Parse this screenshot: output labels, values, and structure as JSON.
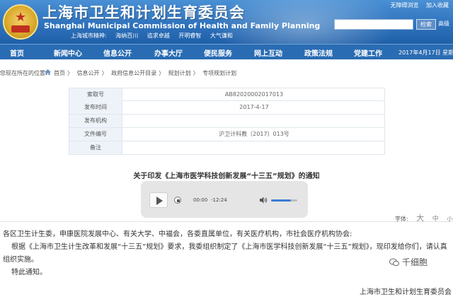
{
  "header": {
    "title_cn": "上海市卫生和计划生育委员会",
    "title_en": "Shanghai Municipal Commission of Health and Family Planning",
    "spirit_label": "上海城市精神:",
    "spirit_items": [
      "海纳百川",
      "追求卓越",
      "开明睿智",
      "大气谦和"
    ],
    "top_links": [
      "无障碍浏览",
      "加入收藏"
    ],
    "search_placeholder": "",
    "search_button": "检索",
    "advanced_search": "高级"
  },
  "nav": {
    "items": [
      "首页",
      "新闻中心",
      "信息公开",
      "办事大厅",
      "便民服务",
      "网上互动",
      "政策法规",
      "党建工作"
    ],
    "date": "2017年4月17日 星期"
  },
  "breadcrumb": {
    "label": "您现在所在的位置:",
    "items": [
      "首页",
      "信息公开",
      "政府信息公开目录",
      "规划计划",
      "专项规划计划"
    ],
    "separator": "〉"
  },
  "meta": {
    "rows": [
      {
        "key": "索取号",
        "value": "AB82020002017013"
      },
      {
        "key": "发布时间",
        "value": "2017-4-17"
      },
      {
        "key": "发布机构",
        "value": ""
      },
      {
        "key": "文件编号",
        "value": "沪卫计科教〔2017〕013号"
      },
      {
        "key": "备注",
        "value": ""
      }
    ]
  },
  "document": {
    "title": "关于印发《上海市医学科技创新发展“十三五”规划》的通知"
  },
  "player": {
    "elapsed": "00:00",
    "remaining": "-12:24",
    "volume": 0.75
  },
  "fontsize": {
    "label": "字体:",
    "options": [
      "大",
      "中",
      "小"
    ]
  },
  "body": {
    "p1": "各区卫生计生委，申康医院发展中心、有关大学、中福会，各委直属单位，有关医疗机构，市社会医疗机构协会:",
    "p2": "根据《上海市卫生计生改革和发展“十三五”规划》要求，我委组织制定了《上海市医学科技创新发展“十三五”规划》，现印发给你们，请认真组织实施。",
    "p3": "特此通知。"
  },
  "watermark": {
    "brand": "千细胞",
    "source": "上海市卫生和计划生育委员会"
  },
  "colors": {
    "header_blue": "#2f73bd",
    "nav_blue": "#2a6cb3",
    "volume_accent": "#3a7bd5"
  }
}
